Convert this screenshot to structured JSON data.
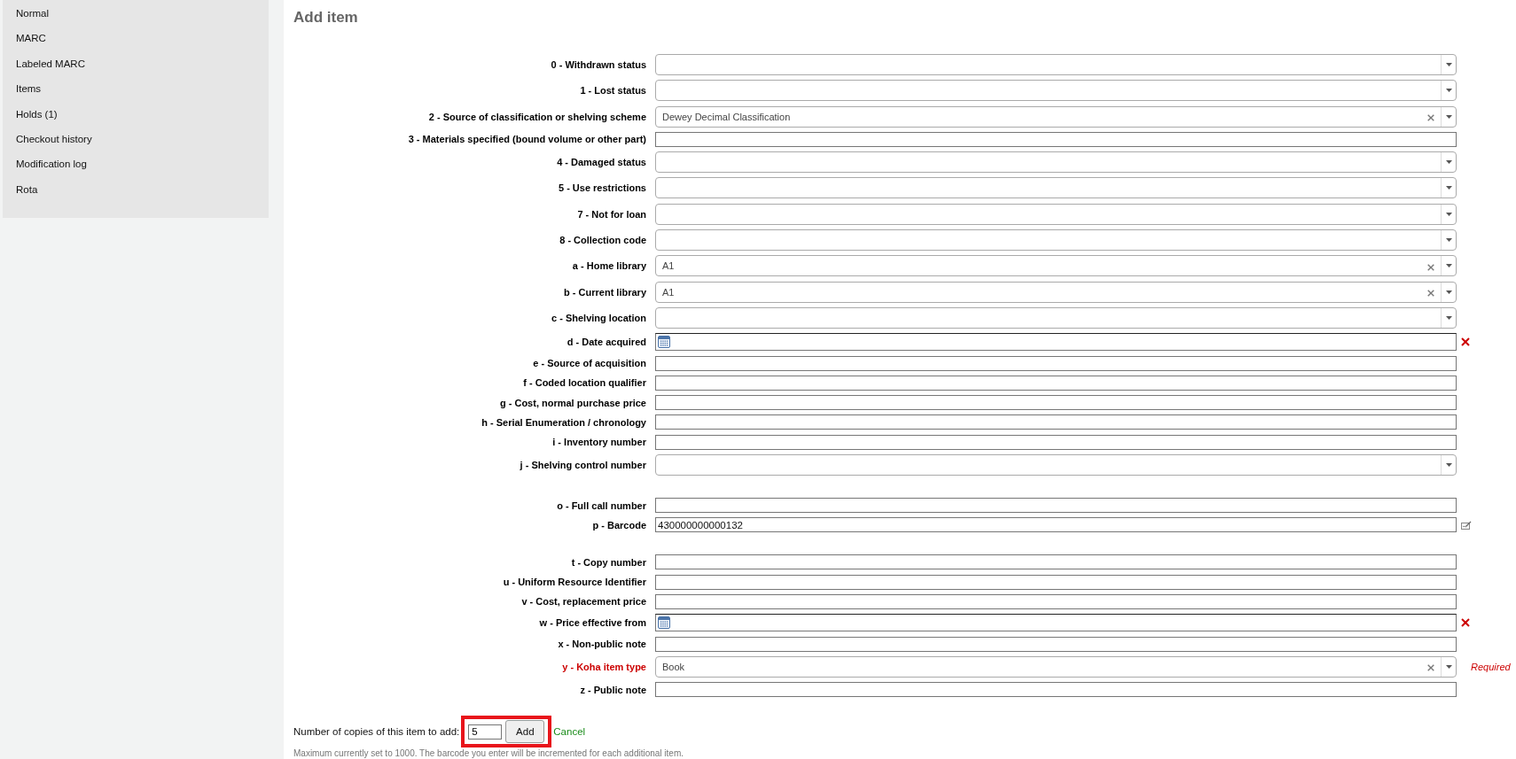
{
  "sidebar": {
    "items": [
      {
        "label": "Normal"
      },
      {
        "label": "MARC"
      },
      {
        "label": "Labeled MARC"
      },
      {
        "label": "Items"
      },
      {
        "label": "Holds (1)"
      },
      {
        "label": "Checkout history"
      },
      {
        "label": "Modification log"
      },
      {
        "label": "Rota"
      }
    ]
  },
  "page_title": "Add item",
  "field_groups": [
    {
      "fields": [
        {
          "label": "0 - Withdrawn status",
          "kind": "select",
          "required": false
        },
        {
          "label": "1 - Lost status",
          "kind": "select",
          "required": false
        },
        {
          "label": "2 - Source of classification or shelving scheme",
          "kind": "select",
          "value": "Dewey Decimal Classification",
          "required": false
        },
        {
          "label": "3 - Materials specified (bound volume or other part)",
          "kind": "text",
          "required": false
        },
        {
          "label": "4 - Damaged status",
          "kind": "select",
          "required": false
        },
        {
          "label": "5 - Use restrictions",
          "kind": "select",
          "required": false
        },
        {
          "label": "7 - Not for loan",
          "kind": "select",
          "required": false
        },
        {
          "label": "8 - Collection code",
          "kind": "select",
          "required": false
        },
        {
          "label": "a - Home library",
          "kind": "select",
          "value": "A1",
          "required": false
        },
        {
          "label": "b - Current library",
          "kind": "select",
          "value": "A1",
          "required": false
        },
        {
          "label": "c - Shelving location",
          "kind": "select",
          "required": false
        },
        {
          "label": "d - Date acquired",
          "kind": "date",
          "required": false
        },
        {
          "label": "e - Source of acquisition",
          "kind": "text",
          "required": false
        },
        {
          "label": "f - Coded location qualifier",
          "kind": "text",
          "required": false
        },
        {
          "label": "g - Cost, normal purchase price",
          "kind": "text",
          "required": false
        },
        {
          "label": "h - Serial Enumeration / chronology",
          "kind": "text",
          "required": false
        },
        {
          "label": "i - Inventory number",
          "kind": "text",
          "required": false
        },
        {
          "label": "j - Shelving control number",
          "kind": "select",
          "required": false
        }
      ]
    },
    {
      "fields": [
        {
          "label": "o - Full call number",
          "kind": "text",
          "required": false
        },
        {
          "label": "p - Barcode",
          "kind": "builder",
          "value": "430000000000132",
          "required": false
        }
      ]
    },
    {
      "fields": [
        {
          "label": "t - Copy number",
          "kind": "text",
          "required": false
        },
        {
          "label": "u - Uniform Resource Identifier",
          "kind": "text",
          "required": false
        },
        {
          "label": "v - Cost, replacement price",
          "kind": "text",
          "required": false
        },
        {
          "label": "w - Price effective from",
          "kind": "date",
          "required": false
        },
        {
          "label": "x - Non-public note",
          "kind": "text",
          "required": false
        },
        {
          "label": "y - Koha item type",
          "kind": "select",
          "value": "Book",
          "required": true,
          "note": "Required"
        },
        {
          "label": "z - Public note",
          "kind": "text",
          "required": false
        }
      ]
    }
  ],
  "copies": {
    "label": "Number of copies of this item to add:",
    "value": "5",
    "highlighted": true,
    "add_button": "Add",
    "cancel_link": "Cancel",
    "hint": "Maximum currently set to 1000. The barcode you enter will be incremented for each additional item."
  }
}
